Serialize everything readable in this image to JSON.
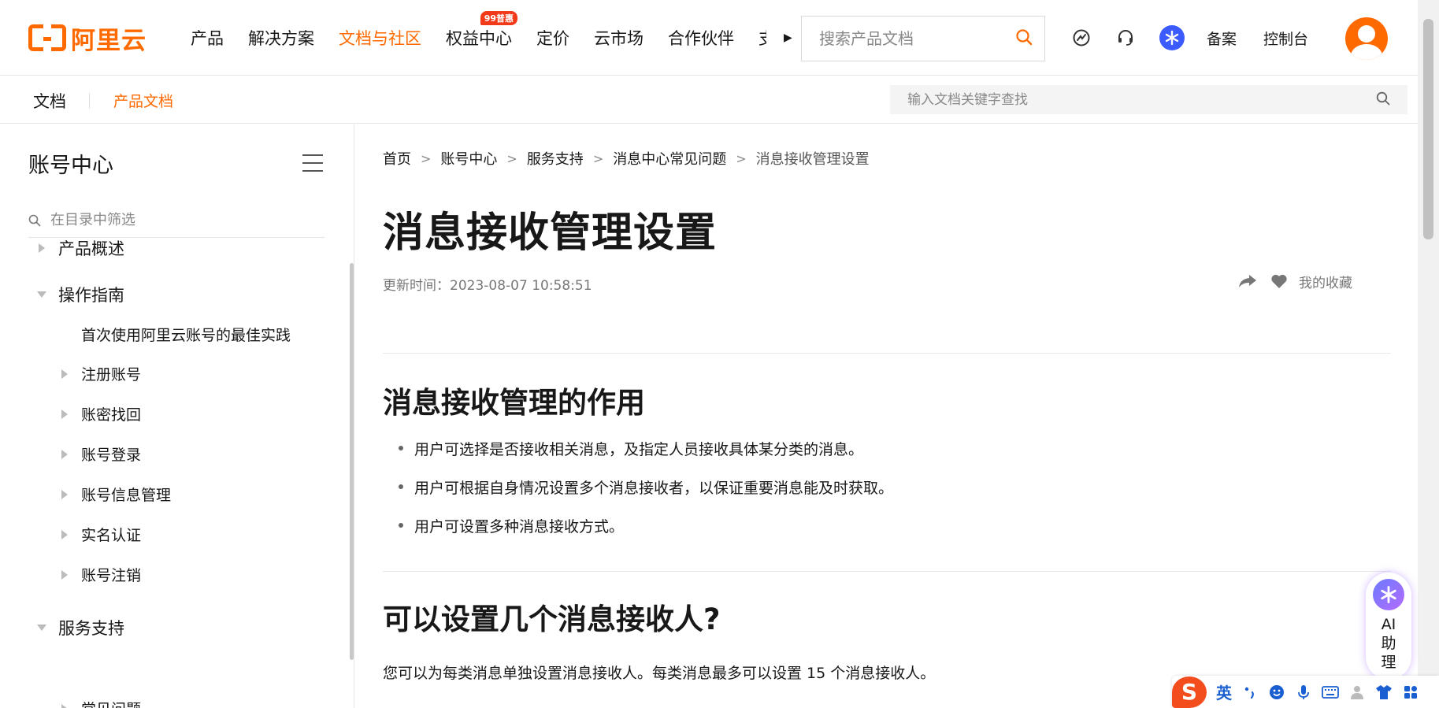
{
  "header": {
    "logo_text": "阿里云",
    "nav": [
      {
        "label": "产品"
      },
      {
        "label": "解决方案"
      },
      {
        "label": "文档与社区",
        "active": true
      },
      {
        "label": "权益中心",
        "badge": "99普惠"
      },
      {
        "label": "定价"
      },
      {
        "label": "云市场"
      },
      {
        "label": "合作伙伴"
      }
    ],
    "nav_overflow": "支",
    "search_placeholder": "搜索产品文档",
    "links": [
      "备案",
      "控制台"
    ],
    "accent_color": "#ff6a00"
  },
  "subnav": {
    "title": "文档",
    "link": "产品文档",
    "search_placeholder": "输入文档关键字查找"
  },
  "sidebar": {
    "title": "账号中心",
    "filter_placeholder": "在目录中筛选",
    "items": [
      {
        "label": "产品概述",
        "level": 1,
        "state": "collapsed"
      },
      {
        "label": "操作指南",
        "level": 1,
        "state": "expanded"
      },
      {
        "label": "首次使用阿里云账号的最佳实践",
        "level": 2,
        "state": "leaf"
      },
      {
        "label": "注册账号",
        "level": 2,
        "state": "collapsed"
      },
      {
        "label": "账密找回",
        "level": 2,
        "state": "collapsed"
      },
      {
        "label": "账号登录",
        "level": 2,
        "state": "collapsed"
      },
      {
        "label": "账号信息管理",
        "level": 2,
        "state": "collapsed"
      },
      {
        "label": "实名认证",
        "level": 2,
        "state": "collapsed"
      },
      {
        "label": "账号注销",
        "level": 2,
        "state": "collapsed"
      },
      {
        "label": "服务支持",
        "level": 1,
        "state": "expanded"
      },
      {
        "label": "常见问题",
        "level": 2,
        "state": "collapsed"
      }
    ]
  },
  "main": {
    "breadcrumb": [
      "首页",
      "账号中心",
      "服务支持",
      "消息中心常见问题",
      "消息接收管理设置"
    ],
    "title": "消息接收管理设置",
    "updated": "更新时间：2023-08-07 10:58:51",
    "favorite_label": "我的收藏",
    "section1_title": "消息接收管理的作用",
    "section1_bullets": [
      "用户可选择是否接收相关消息，及指定人员接收具体某分类的消息。",
      "用户可根据自身情况设置多个消息接收者，以保证重要消息能及时获取。",
      "用户可设置多种消息接收方式。"
    ],
    "section2_title": "可以设置几个消息接收人?",
    "section2_para": "您可以为每类消息单独设置消息接收人。每类消息最多可以设置 15 个消息接收人。"
  },
  "ai_helper": {
    "label": "AI助理"
  },
  "ime": {
    "logo": "S",
    "lang": "英"
  }
}
